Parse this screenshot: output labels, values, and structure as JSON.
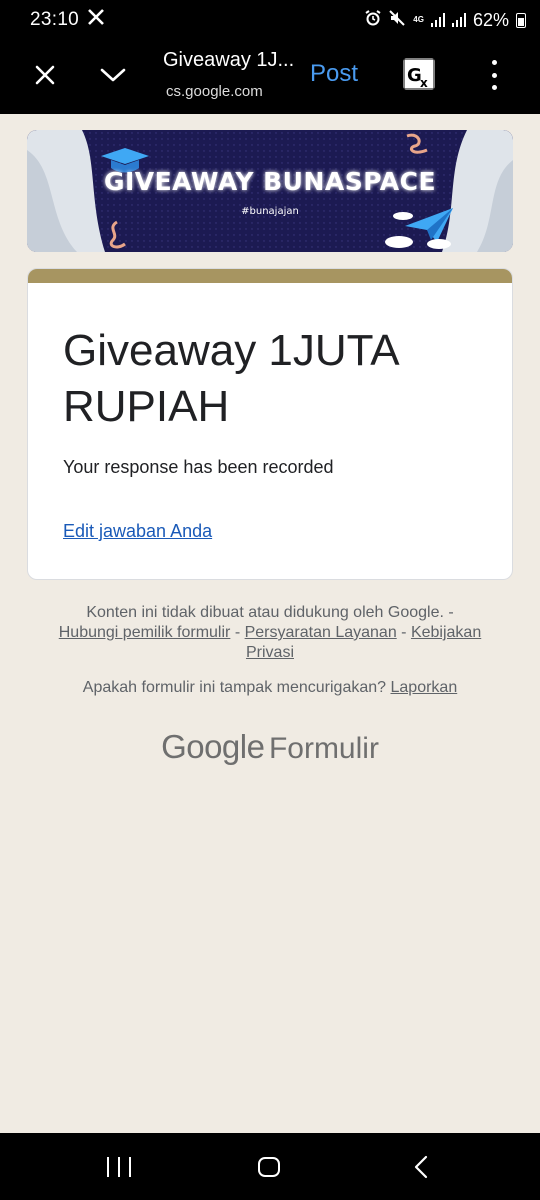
{
  "status_bar": {
    "time": "23:10",
    "network": "4G",
    "battery": "62%",
    "icons": [
      "x-logo-icon",
      "alarm-icon",
      "mute-icon",
      "signal-icon",
      "battery-icon"
    ]
  },
  "toolbar": {
    "title": "Giveaway 1J...",
    "url": "cs.google.com",
    "post_label": "Post",
    "icons": [
      "close-icon",
      "chevron-down-icon",
      "translate-icon",
      "more-vert-icon"
    ]
  },
  "banner": {
    "title": "GIVEAWAY BUNASPACE",
    "hashtag": "#bunajajan",
    "colors": {
      "background": "#1c1a52",
      "accent": "#3fa8f4"
    }
  },
  "form": {
    "title": "Giveaway 1JUTA RUPIAH",
    "confirmation": "Your response has been recorded",
    "edit_link": "Edit jawaban Anda",
    "accent_color": "#a79561"
  },
  "footer": {
    "disclaimer": "Konten ini tidak dibuat atau didukung oleh Google. -",
    "links": [
      "Hubungi pemilik formulir",
      "Persyaratan Layanan",
      "Kebijakan Privasi"
    ],
    "separator": "-",
    "report_question": "Apakah formulir ini tampak mencurigakan?",
    "report_link": "Laporkan",
    "logo_google": "Google",
    "logo_product": "Formulir"
  },
  "navbar": {
    "icons": [
      "recents-icon",
      "home-icon",
      "back-icon"
    ]
  }
}
